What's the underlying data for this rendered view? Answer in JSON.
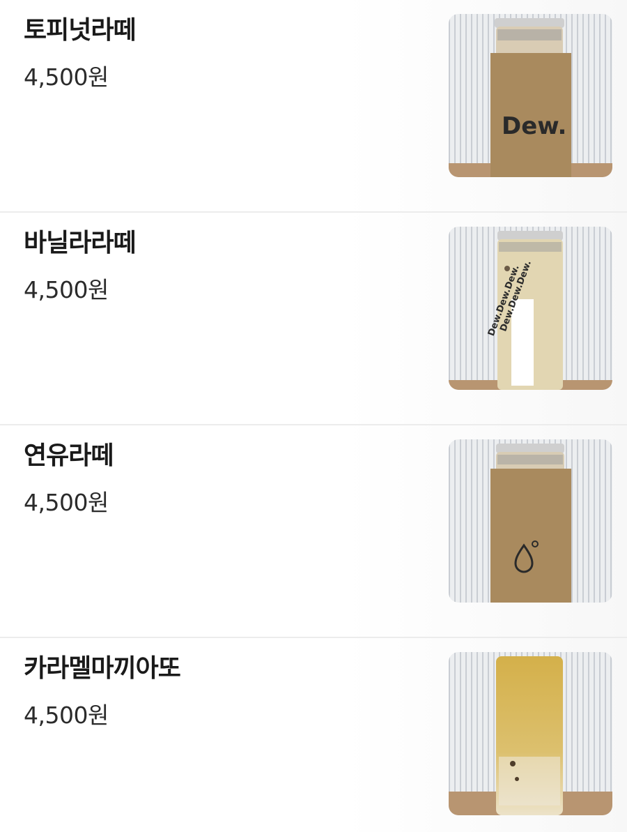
{
  "menu": {
    "items": [
      {
        "name": "토피넛라떼",
        "price": "4,500원",
        "sleeve": "kraft-dew",
        "sleeve_text": "Dew.",
        "drink_color": "#d9ccb4"
      },
      {
        "name": "바닐라라떼",
        "price": "4,500원",
        "sleeve": "pattern-label",
        "sleeve_text": "Dew.Dew.Dew.",
        "drink_color": "#e3d7b2"
      },
      {
        "name": "연유라떼",
        "price": "4,500원",
        "sleeve": "kraft-drop",
        "sleeve_text": "",
        "drink_color": "#d8ccb4"
      },
      {
        "name": "카라멜마끼아또",
        "price": "4,500원",
        "sleeve": "none",
        "sleeve_text": "",
        "drink_color": "#d9b75a"
      }
    ]
  },
  "colors": {
    "kraft": "#a98a5e",
    "backdrop_stripe": "#c7ccd3",
    "table_wood": "#b99570"
  }
}
